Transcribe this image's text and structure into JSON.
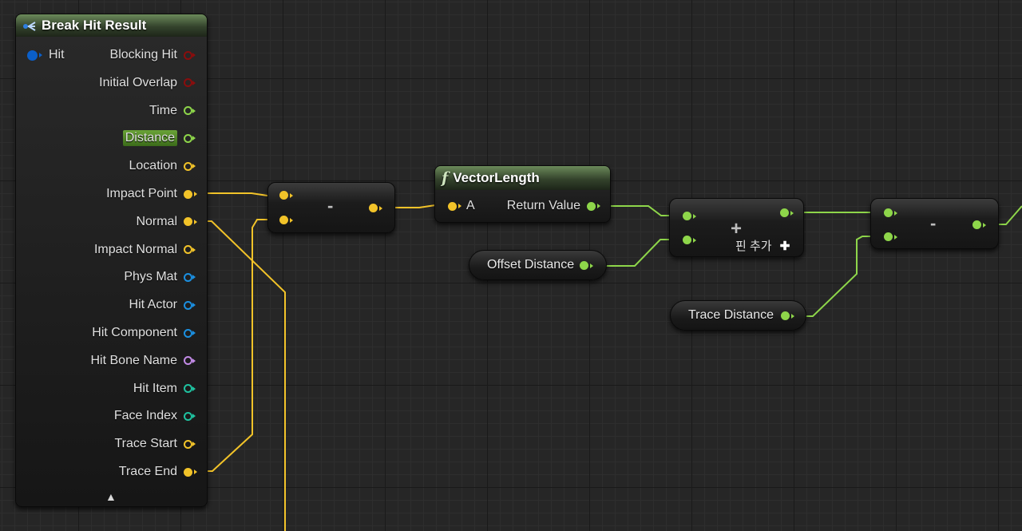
{
  "break_hit_result": {
    "title": "Break Hit Result",
    "input_pin": "Hit",
    "outputs": [
      {
        "label": "Blocking Hit",
        "type": "bool",
        "color": "#8a0d0d",
        "connected": false
      },
      {
        "label": "Initial Overlap",
        "type": "bool",
        "color": "#8a0d0d",
        "connected": false
      },
      {
        "label": "Time",
        "type": "float",
        "color": "#8ed64a",
        "connected": false
      },
      {
        "label": "Distance",
        "type": "float",
        "color": "#8ed64a",
        "connected": false,
        "highlighted": true
      },
      {
        "label": "Location",
        "type": "vector",
        "color": "#f2c329",
        "connected": false
      },
      {
        "label": "Impact Point",
        "type": "vector",
        "color": "#f2c329",
        "connected": true
      },
      {
        "label": "Normal",
        "type": "vector",
        "color": "#f2c329",
        "connected": true
      },
      {
        "label": "Impact Normal",
        "type": "vector",
        "color": "#f2c329",
        "connected": false
      },
      {
        "label": "Phys Mat",
        "type": "object",
        "color": "#1b8fe0",
        "connected": false
      },
      {
        "label": "Hit Actor",
        "type": "object",
        "color": "#1b8fe0",
        "connected": false
      },
      {
        "label": "Hit Component",
        "type": "object",
        "color": "#1b8fe0",
        "connected": false
      },
      {
        "label": "Hit Bone Name",
        "type": "name",
        "color": "#c28be6",
        "connected": false
      },
      {
        "label": "Hit Item",
        "type": "int",
        "color": "#1fc2a0",
        "connected": false
      },
      {
        "label": "Face Index",
        "type": "int",
        "color": "#1fc2a0",
        "connected": false
      },
      {
        "label": "Trace Start",
        "type": "vector",
        "color": "#f2c329",
        "connected": false
      },
      {
        "label": "Trace End",
        "type": "vector",
        "color": "#f2c329",
        "connected": true
      }
    ],
    "collapse_glyph": "▲"
  },
  "subtract_vector": {
    "symbol": "-"
  },
  "vector_length": {
    "title": "VectorLength",
    "func_glyph": "f",
    "input_label": "A",
    "output_label": "Return Value"
  },
  "add_float": {
    "symbol": "+",
    "add_pin_label": "핀 추가",
    "add_pin_glyph": "✚"
  },
  "subtract_float": {
    "symbol": "-"
  },
  "offset_distance": {
    "label": "Offset Distance"
  },
  "trace_distance": {
    "label": "Trace Distance"
  },
  "colors": {
    "vector": "#f2c329",
    "float": "#8ed64a",
    "struct": "#0b5fc9",
    "bool": "#8a0d0d"
  }
}
